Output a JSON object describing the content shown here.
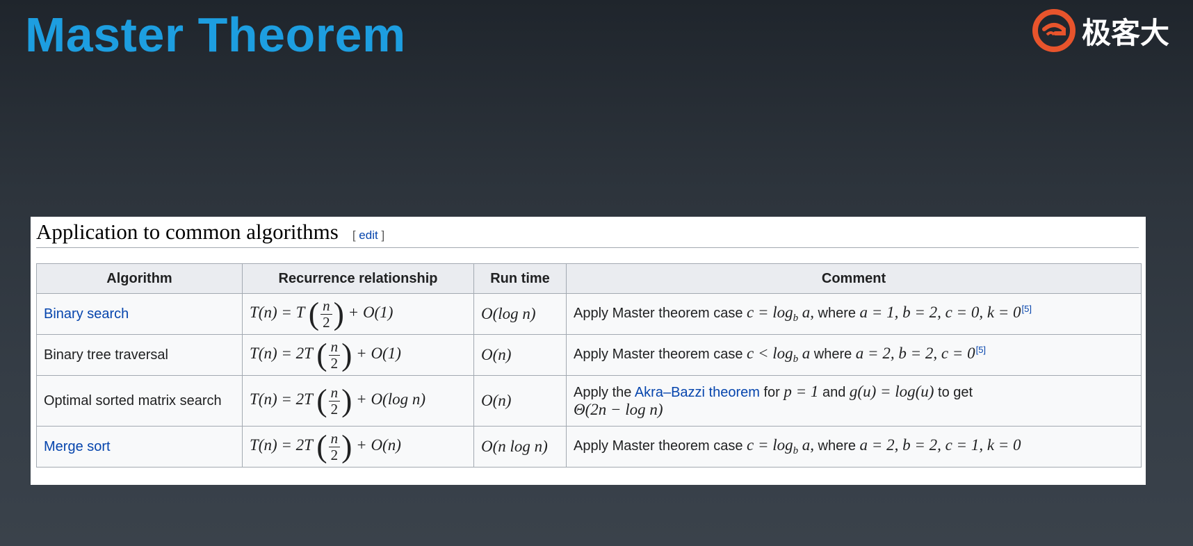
{
  "slide": {
    "title": "Master Theorem",
    "title_color": "#1d9ee0"
  },
  "logo": {
    "icon": "geekbang-logo-icon",
    "text": "极客大",
    "color": "#e8542c"
  },
  "section": {
    "title": "Application to common algorithms",
    "edit_open": "[",
    "edit_label": "edit",
    "edit_close": "]"
  },
  "table": {
    "headers": [
      "Algorithm",
      "Recurrence relationship",
      "Run time",
      "Comment"
    ],
    "rows": [
      {
        "algorithm": "Binary search",
        "run_time": "O(log n)",
        "comment_prefix": "Apply Master theorem case",
        "comment_math1": "c = log",
        "comment_sub": "b",
        "comment_math2": "a,",
        "comment_mid": "where",
        "comment_math3": "a = 1, b = 2, c = 0, k = 0",
        "ref": "[5]"
      },
      {
        "algorithm": "Binary tree traversal",
        "run_time": "O(n)",
        "comment_prefix": "Apply Master theorem case",
        "comment_math1": "c < log",
        "comment_sub": "b",
        "comment_math2": "a",
        "comment_mid": "where",
        "comment_math3": "a = 2, b = 2, c = 0",
        "ref": "[5]"
      },
      {
        "algorithm": "Optimal sorted matrix search",
        "run_time": "O(n)",
        "comment_a": "Apply the",
        "comment_link": "Akra–Bazzi theorem",
        "comment_b": "for",
        "comment_m1": "p = 1",
        "comment_c": "and",
        "comment_m2": "g(u) = log(u)",
        "comment_d": "to get",
        "comment_m3": "Θ(2n − log n)"
      },
      {
        "algorithm": "Merge sort",
        "run_time": "O(n log n)",
        "comment_prefix": "Apply Master theorem case",
        "comment_math1": "c = log",
        "comment_sub": "b",
        "comment_math2": "a,",
        "comment_mid": "where",
        "comment_math3": "a = 2, b = 2, c = 1, k = 0"
      }
    ],
    "recurrence": [
      {
        "lhs": "T(n) = T",
        "num": "n",
        "den": "2",
        "rhs": "+ O(1)"
      },
      {
        "lhs": "T(n) = 2T",
        "num": "n",
        "den": "2",
        "rhs": "+ O(1)"
      },
      {
        "lhs": "T(n) = 2T",
        "num": "n",
        "den": "2",
        "rhs": "+ O(log n)"
      },
      {
        "lhs": "T(n) = 2T",
        "num": "n",
        "den": "2",
        "rhs": "+ O(n)"
      }
    ]
  }
}
